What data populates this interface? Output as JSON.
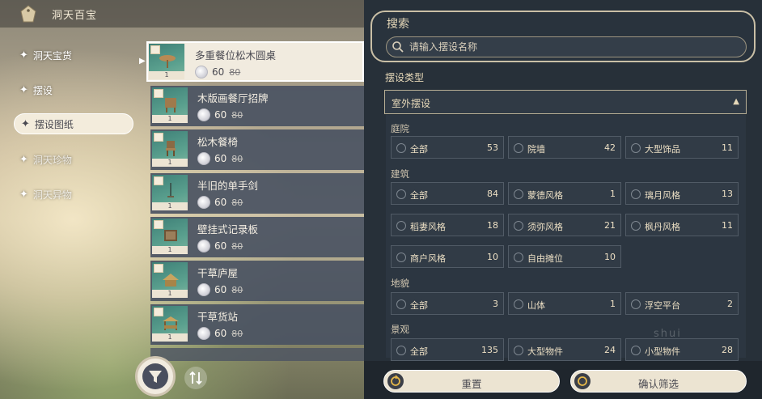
{
  "header": {
    "title": "洞天百宝"
  },
  "categories": [
    {
      "label": "洞天宝货"
    },
    {
      "label": "摆设"
    },
    {
      "label": "摆设图纸"
    },
    {
      "label": "洞天珍物"
    },
    {
      "label": "洞天异物"
    }
  ],
  "items": [
    {
      "name": "多重餐位松木圆桌",
      "price": "60",
      "old_price": "80",
      "qty": "1"
    },
    {
      "name": "木版画餐厅招牌",
      "price": "60",
      "old_price": "80",
      "qty": "1"
    },
    {
      "name": "松木餐椅",
      "price": "60",
      "old_price": "80",
      "qty": "1"
    },
    {
      "name": "半旧的单手剑",
      "price": "60",
      "old_price": "80",
      "qty": "1"
    },
    {
      "name": "壁挂式记录板",
      "price": "60",
      "old_price": "80",
      "qty": "1"
    },
    {
      "name": "干草庐屋",
      "price": "60",
      "old_price": "80",
      "qty": "1"
    },
    {
      "name": "干草货站",
      "price": "60",
      "old_price": "80",
      "qty": "1"
    }
  ],
  "search": {
    "label": "搜索",
    "placeholder": "请输入摆设名称"
  },
  "type_filter": {
    "label": "摆设类型",
    "selected": "室外摆设"
  },
  "sections": [
    {
      "title": "庭院",
      "options": [
        {
          "label": "全部",
          "count": "53"
        },
        {
          "label": "院墙",
          "count": "42"
        },
        {
          "label": "大型饰品",
          "count": "11"
        }
      ]
    },
    {
      "title": "建筑",
      "options": [
        {
          "label": "全部",
          "count": "84"
        },
        {
          "label": "蒙德风格",
          "count": "1"
        },
        {
          "label": "璃月风格",
          "count": "13"
        },
        {
          "label": "稻妻风格",
          "count": "18"
        },
        {
          "label": "须弥风格",
          "count": "21"
        },
        {
          "label": "枫丹风格",
          "count": "11"
        },
        {
          "label": "商户风格",
          "count": "10"
        },
        {
          "label": "自由摊位",
          "count": "10"
        }
      ]
    },
    {
      "title": "地貌",
      "options": [
        {
          "label": "全部",
          "count": "3"
        },
        {
          "label": "山体",
          "count": "1"
        },
        {
          "label": "浮空平台",
          "count": "2"
        }
      ]
    },
    {
      "title": "景观",
      "options": [
        {
          "label": "全部",
          "count": "135"
        },
        {
          "label": "大型物件",
          "count": "24"
        },
        {
          "label": "小型物件",
          "count": "28"
        }
      ]
    }
  ],
  "buttons": {
    "reset": "重置",
    "confirm": "确认筛选"
  },
  "watermark": "shui"
}
